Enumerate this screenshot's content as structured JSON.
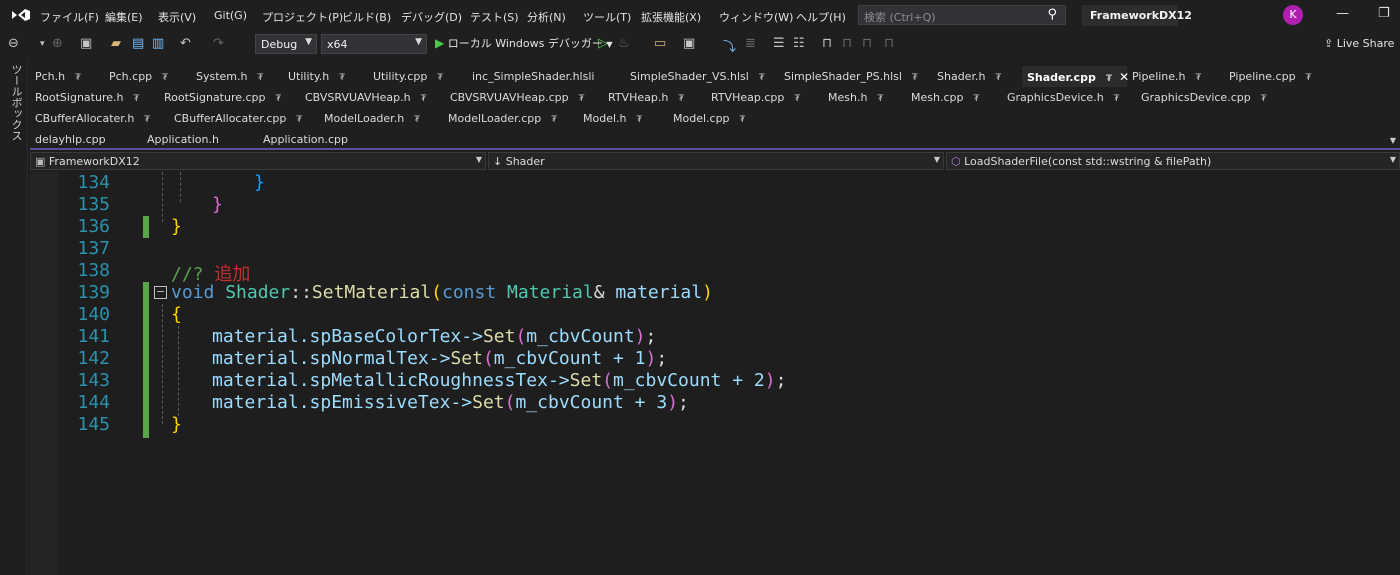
{
  "menu": {
    "items": [
      "ファイル(F)",
      "編集(E)",
      "表示(V)",
      "Git(G)",
      "プロジェクト(P)",
      "ビルド(B)",
      "デバッグ(D)",
      "テスト(S)",
      "分析(N)",
      "ツール(T)",
      "拡張機能(X)",
      "ウィンドウ(W)",
      "ヘルプ(H)"
    ]
  },
  "search": {
    "placeholder": "検索 (Ctrl+Q)"
  },
  "project_name": "FrameworkDX12",
  "user_initial": "K",
  "toolbar": {
    "config": "Debug",
    "platform": "x64",
    "run_label": "ローカル Windows デバッガー",
    "live_share": "Live Share"
  },
  "toolbox_label": "ツールボックス",
  "tabs": {
    "row1": [
      "Pch.h",
      "Pch.cpp",
      "System.h",
      "Utility.h",
      "Utility.cpp",
      "inc_SimpleShader.hlsli",
      "SimpleShader_VS.hlsl",
      "SimpleShader_PS.hlsl",
      "Shader.h",
      "Shader.cpp",
      "Pipeline.h",
      "Pipeline.cpp"
    ],
    "row2": [
      "RootSignature.h",
      "RootSignature.cpp",
      "CBVSRVUAVHeap.h",
      "CBVSRVUAVHeap.cpp",
      "RTVHeap.h",
      "RTVHeap.cpp",
      "Mesh.h",
      "Mesh.cpp",
      "GraphicsDevice.h",
      "GraphicsDevice.cpp"
    ],
    "row3": [
      "CBufferAllocater.h",
      "CBufferAllocater.cpp",
      "ModelLoader.h",
      "ModelLoader.cpp",
      "Model.h",
      "Model.cpp"
    ],
    "row4": [
      "delayhlp.cpp",
      "Application.h",
      "Application.cpp"
    ],
    "active": "Shader.cpp"
  },
  "navbar": {
    "project": "FrameworkDX12",
    "scope": "Shader",
    "member": "LoadShaderFile(const std::wstring & filePath)"
  },
  "editor": {
    "line_numbers": [
      "134",
      "135",
      "136",
      "137",
      "138",
      "139",
      "140",
      "141",
      "142",
      "143",
      "144",
      "145"
    ],
    "comment": "//? 追加",
    "l139": {
      "kw": "void",
      "cls": "Shader",
      "sep": "::",
      "fn": "SetMaterial",
      "op": "(",
      "ckw": "const",
      "type": "Material",
      "amp": "&",
      "param": "material",
      "cp": ")"
    },
    "l141": {
      "obj": "material.",
      "mem": "spBaseColorTex->",
      "fn": "Set",
      "args": "m_cbvCount",
      "tail": ";"
    },
    "l142": {
      "obj": "material.",
      "mem": "spNormalTex->",
      "fn": "Set",
      "args": "m_cbvCount + 1",
      "tail": ";"
    },
    "l143": {
      "obj": "material.",
      "mem": "spMetallicRoughnessTex->",
      "fn": "Set",
      "args": "m_cbvCount + 2",
      "tail": ";"
    },
    "l144": {
      "obj": "material.",
      "mem": "spEmissiveTex->",
      "fn": "Set",
      "args": "m_cbvCount + 3",
      "tail": ";"
    },
    "brace_open": "{",
    "brace_close": "}"
  },
  "colors": {
    "keyword": "#569cd6",
    "type": "#4ec9b0",
    "function": "#dcdcaa",
    "param": "#9cdcfe",
    "comment": "#57a64a",
    "line_number": "#2b91af",
    "change_bar": "#57a64a"
  }
}
